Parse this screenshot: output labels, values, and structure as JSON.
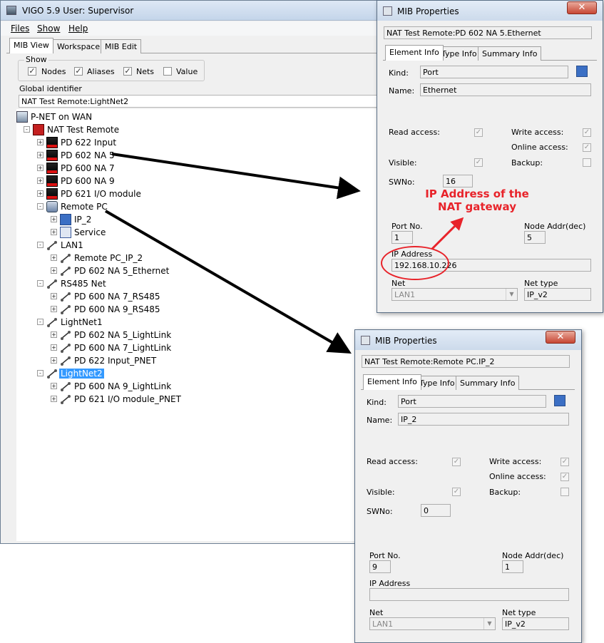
{
  "main": {
    "title": "VIGO 5.9   User: Supervisor",
    "menu": [
      "Files",
      "Show",
      "Help"
    ],
    "tabs": [
      "MIB View",
      "Workspace",
      "MIB Edit"
    ],
    "show": {
      "legend": "Show",
      "options": [
        {
          "label": "Nodes",
          "checked": true
        },
        {
          "label": "Aliases",
          "checked": true
        },
        {
          "label": "Nets",
          "checked": true
        },
        {
          "label": "Value",
          "checked": false
        }
      ]
    },
    "global_identifier_label": "Global identifier",
    "global_identifier_value": "NAT Test Remote:LightNet2",
    "tree": [
      {
        "label": "P-NET on WAN",
        "icon": "computer-icon",
        "expander": ""
      },
      {
        "label": "NAT Test Remote",
        "icon": "nat-device-icon",
        "expander": "-"
      },
      {
        "label": "PD 622 Input",
        "icon": "module-icon",
        "expander": "+"
      },
      {
        "label": "PD 602 NA 5",
        "icon": "module-icon",
        "expander": "+"
      },
      {
        "label": "PD 600 NA 7",
        "icon": "module-icon",
        "expander": "+"
      },
      {
        "label": "PD 600 NA 9",
        "icon": "module-icon",
        "expander": "+"
      },
      {
        "label": "PD 621 I/O module",
        "icon": "module-icon",
        "expander": "+"
      },
      {
        "label": "Remote PC",
        "icon": "pc-icon",
        "expander": "-"
      },
      {
        "label": "IP_2",
        "icon": "port-icon",
        "expander": "+"
      },
      {
        "label": "Service",
        "icon": "service-icon",
        "expander": "+"
      },
      {
        "label": "LAN1",
        "icon": "net-icon",
        "expander": "-"
      },
      {
        "label": "Remote PC_IP_2",
        "icon": "link-icon",
        "expander": "+"
      },
      {
        "label": "PD 602 NA 5_Ethernet",
        "icon": "link-icon",
        "expander": "+"
      },
      {
        "label": "RS485 Net",
        "icon": "net-icon",
        "expander": "-"
      },
      {
        "label": "PD 600 NA 7_RS485",
        "icon": "link-icon",
        "expander": "+"
      },
      {
        "label": "PD 600 NA 9_RS485",
        "icon": "link-icon",
        "expander": "+"
      },
      {
        "label": "LightNet1",
        "icon": "net-icon",
        "expander": "-"
      },
      {
        "label": "PD 602 NA 5_LightLink",
        "icon": "link-icon",
        "expander": "+"
      },
      {
        "label": "PD 600 NA 7_LightLink",
        "icon": "link-icon",
        "expander": "+"
      },
      {
        "label": "PD 622 Input_PNET",
        "icon": "link-icon",
        "expander": "+"
      },
      {
        "label": "LightNet2",
        "icon": "net-icon",
        "expander": "-"
      },
      {
        "label": "PD 600 NA 9_LightLink",
        "icon": "link-icon",
        "expander": "+"
      },
      {
        "label": "PD 621 I/O module_PNET",
        "icon": "link-icon",
        "expander": "+"
      }
    ]
  },
  "dialog1": {
    "title": "MIB Properties",
    "path": "NAT Test Remote:PD 602 NA 5.Ethernet",
    "tabs": [
      "Element Info",
      "Type Info",
      "Summary Info"
    ],
    "kind_label": "Kind:",
    "kind": "Port",
    "name_label": "Name:",
    "name": "Ethernet",
    "read_access_label": "Read access:",
    "write_access_label": "Write access:",
    "online_access_label": "Online access:",
    "visible_label": "Visible:",
    "backup_label": "Backup:",
    "swno_label": "SWNo:",
    "swno": "16",
    "port_label": "Port No.",
    "port": "1",
    "node_addr_label": "Node Addr(dec)",
    "node_addr": "5",
    "ip_label": "IP Address",
    "ip": "192.168.10.226",
    "net_label": "Net",
    "net": "LAN1",
    "net_type_label": "Net type",
    "net_type": "IP_v2"
  },
  "dialog2": {
    "title": "MIB Properties",
    "path": "NAT Test Remote:Remote PC.IP_2",
    "tabs": [
      "Element Info",
      "Type Info",
      "Summary Info"
    ],
    "kind_label": "Kind:",
    "kind": "Port",
    "name_label": "Name:",
    "name": "IP_2",
    "read_access_label": "Read access:",
    "write_access_label": "Write access:",
    "online_access_label": "Online access:",
    "visible_label": "Visible:",
    "backup_label": "Backup:",
    "swno_label": "SWNo:",
    "swno": "0",
    "port_label": "Port No.",
    "port": "9",
    "node_addr_label": "Node Addr(dec)",
    "node_addr": "1",
    "ip_label": "IP Address",
    "ip": "",
    "net_label": "Net",
    "net": "LAN1",
    "net_type_label": "Net type",
    "net_type": "IP_v2"
  },
  "annotation": {
    "text": "IP Address of the NAT gateway",
    "color": "#e8232a"
  },
  "colors": {
    "selection": "#3399ff",
    "arrow": "#000000"
  }
}
